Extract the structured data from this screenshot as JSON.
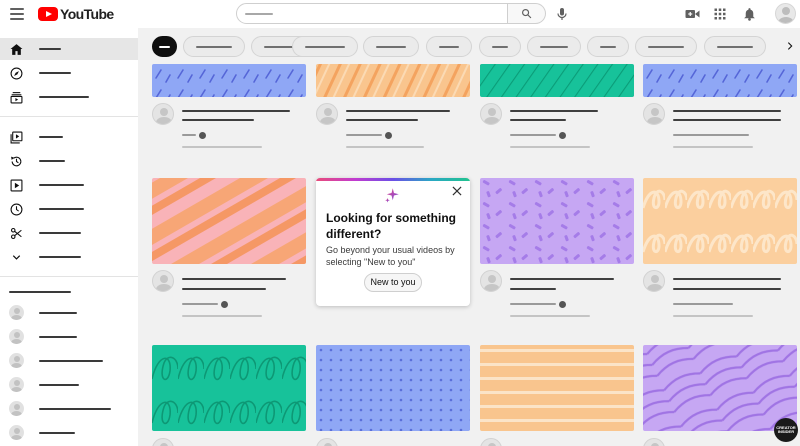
{
  "app": {
    "logo_text": "YouTube"
  },
  "popup": {
    "title": "Looking for something different?",
    "body": "Go beyond your usual videos by selecting \"New to you\"",
    "button_label": "New to you"
  },
  "watermark": {
    "text": "CREATOR INSIDER"
  },
  "colors": {
    "brand_red": "#ff0000",
    "chip_active": "#0f0f0f",
    "thumb_blue": "#8fa7f5",
    "thumb_peach": "#f9c58e",
    "thumb_teal": "#17c29a",
    "thumb_purple": "#c6a7f3",
    "thumb_pink": "#f9b3b8"
  },
  "icons": {
    "header": [
      "menu-icon",
      "search-icon",
      "mic-icon",
      "create-video-icon",
      "apps-icon",
      "notifications-icon"
    ],
    "sidebar": [
      "home-icon",
      "explore-icon",
      "subscriptions-icon",
      "library-icon",
      "history-icon",
      "your-videos-icon",
      "watch-later-icon",
      "clips-icon",
      "show-more-icon"
    ],
    "popup": [
      "sparkle-icon",
      "close-icon"
    ]
  }
}
